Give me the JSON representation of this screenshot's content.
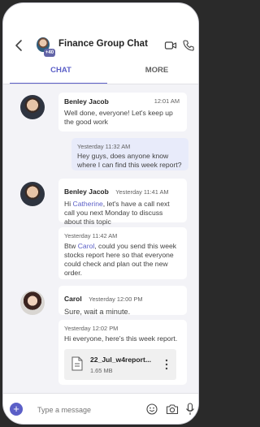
{
  "header": {
    "title": "Finance Group Chat",
    "badge": "+40"
  },
  "tabs": [
    {
      "label": "CHAT",
      "active": true
    },
    {
      "label": "MORE",
      "active": false
    }
  ],
  "messages": [
    {
      "sender": "Benley Jacob",
      "time": "12:01 AM",
      "text": "Well done, everyone! Let's keep up the good work"
    },
    {
      "time": "Yesterday 11:32 AM",
      "text": "Hey guys, does anyone know where I can find this week report?"
    },
    {
      "sender": "Benley Jacob",
      "time": "Yesterday 11:41 AM",
      "text_pre": "Hi ",
      "mention": "Catherine",
      "text_post": ", let's have a call next call you next Monday to discuss about this topic"
    },
    {
      "time": "Yesterday 11:42 AM",
      "text_pre": "Btw ",
      "mention": "Carol",
      "text_post": ", could you send this week stocks report here so that everyone could check and plan out the new order."
    },
    {
      "sender": "Carol",
      "time": "Yesterday 12:00 PM",
      "text": "Sure, wait a minute."
    },
    {
      "time": "Yesterday 12:02 PM",
      "text": "Hi everyone, here's this week report.",
      "file": {
        "name": "22_Jul_w4report...",
        "size": "1.65 MB"
      }
    }
  ],
  "composer": {
    "placeholder": "Type a message"
  },
  "colors": {
    "accent": "#5b5fc7",
    "self_bubble": "#e8ebfa",
    "background": "#f3f3f7"
  }
}
